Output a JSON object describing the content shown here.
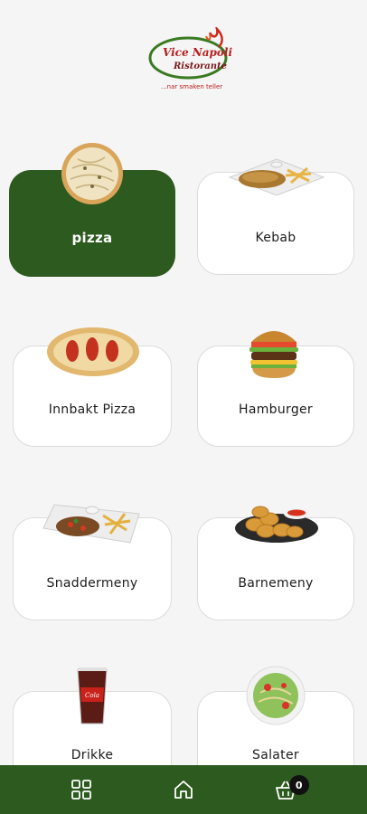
{
  "brand": {
    "name": "Vicenapoli Ristorante",
    "tagline": "...nar smaken teller"
  },
  "categories": [
    {
      "label": "pizza",
      "active": true,
      "icon": "pizza-icon"
    },
    {
      "label": "Kebab",
      "active": false,
      "icon": "kebab-icon"
    },
    {
      "label": "Innbakt Pizza",
      "active": false,
      "icon": "calzone-icon"
    },
    {
      "label": "Hamburger",
      "active": false,
      "icon": "burger-icon"
    },
    {
      "label": "Snaddermeny",
      "active": false,
      "icon": "snadder-plate-icon"
    },
    {
      "label": "Barnemeny",
      "active": false,
      "icon": "nuggets-icon"
    },
    {
      "label": "Drikke",
      "active": false,
      "icon": "cola-cup-icon"
    },
    {
      "label": "Salater",
      "active": false,
      "icon": "salad-icon"
    }
  ],
  "nav": {
    "items": [
      "grid-icon",
      "home-icon",
      "basket-icon"
    ],
    "cart_count": "0"
  },
  "colors": {
    "primary": "#2d5a1e",
    "background": "#f5f5f5"
  }
}
